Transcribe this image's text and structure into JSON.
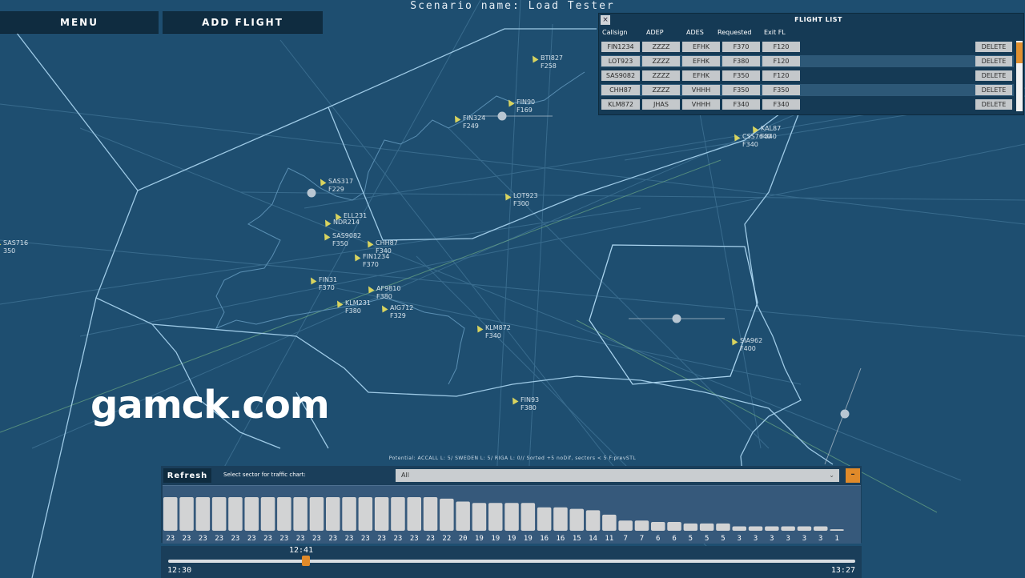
{
  "header": {
    "scenario_title": "Scenario name: Load Tester"
  },
  "toolbar": {
    "menu_label": "MENU",
    "add_flight_label": "ADD FLIGHT"
  },
  "flight_list": {
    "close_icon": "×",
    "title": "FLIGHT LIST",
    "columns": [
      "Callsign",
      "ADEP",
      "ADES",
      "Requested",
      "Exit FL"
    ],
    "rows": [
      {
        "callsign": "FIN1234",
        "adep": "ZZZZ",
        "ades": "EFHK",
        "requested": "F370",
        "exit_fl": "F120",
        "delete_label": "DELETE"
      },
      {
        "callsign": "LOT923",
        "adep": "ZZZZ",
        "ades": "EFHK",
        "requested": "F380",
        "exit_fl": "F120",
        "delete_label": "DELETE"
      },
      {
        "callsign": "SAS9082",
        "adep": "ZZZZ",
        "ades": "EFHK",
        "requested": "F350",
        "exit_fl": "F120",
        "delete_label": "DELETE"
      },
      {
        "callsign": "CHH87",
        "adep": "ZZZZ",
        "ades": "VHHH",
        "requested": "F350",
        "exit_fl": "F350",
        "delete_label": "DELETE"
      },
      {
        "callsign": "KLM872",
        "adep": "JHAS",
        "ades": "VHHH",
        "requested": "F340",
        "exit_fl": "F340",
        "delete_label": "DELETE"
      }
    ]
  },
  "map": {
    "flights": [
      {
        "callsign": "BTI827",
        "fl": "F258"
      },
      {
        "callsign": "FIN90",
        "fl": "F169"
      },
      {
        "callsign": "FIN324",
        "fl": "F249"
      },
      {
        "callsign": "KAL87",
        "fl": "F340"
      },
      {
        "callsign": "CSS7640",
        "fl": "F340"
      },
      {
        "callsign": "SAS317",
        "fl": "F229"
      },
      {
        "callsign": "LOT923",
        "fl": "F300"
      },
      {
        "callsign": "ELL231",
        "fl": ""
      },
      {
        "callsign": "NDR214",
        "fl": ""
      },
      {
        "callsign": "SAS9082",
        "fl": "F350"
      },
      {
        "callsign": "CHH87",
        "fl": "F340"
      },
      {
        "callsign": "FIN1234",
        "fl": "F370"
      },
      {
        "callsign": "FIN31",
        "fl": "F370"
      },
      {
        "callsign": "AF9810",
        "fl": "F380"
      },
      {
        "callsign": "KLM231",
        "fl": "F380"
      },
      {
        "callsign": "AIG712",
        "fl": "F329"
      },
      {
        "callsign": "KLM872",
        "fl": "F340"
      },
      {
        "callsign": "SIA962",
        "fl": "F400"
      },
      {
        "callsign": "FIN93",
        "fl": "F380"
      },
      {
        "callsign": "SAS716",
        "fl": "350"
      },
      {
        "callsign": "",
        "fl": "F240"
      }
    ],
    "potential_text": "Potential: ACCALL L: 5/ SWEDEN L: 5/ RIGA L: 0// Sorted +5 noDif, sectors < 5 F:prevSTL",
    "watermark": "gamck.com"
  },
  "traffic_panel": {
    "refresh_label": "Refresh",
    "sector_label": "Select sector for traffic chart:",
    "sector_selected": "All",
    "collapse_icon": "–"
  },
  "chart_data": {
    "type": "bar",
    "values": [
      23,
      23,
      23,
      23,
      23,
      23,
      23,
      23,
      23,
      23,
      23,
      23,
      23,
      23,
      23,
      23,
      23,
      22,
      20,
      19,
      19,
      19,
      19,
      16,
      16,
      15,
      14,
      11,
      7,
      7,
      6,
      6,
      5,
      5,
      5,
      3,
      3,
      3,
      3,
      3,
      3,
      1
    ],
    "bar_color": "#d2d3d4"
  },
  "timeline": {
    "current_time": "12:41",
    "start_time": "12:30",
    "end_time": "13:27",
    "progress": 0.2
  }
}
